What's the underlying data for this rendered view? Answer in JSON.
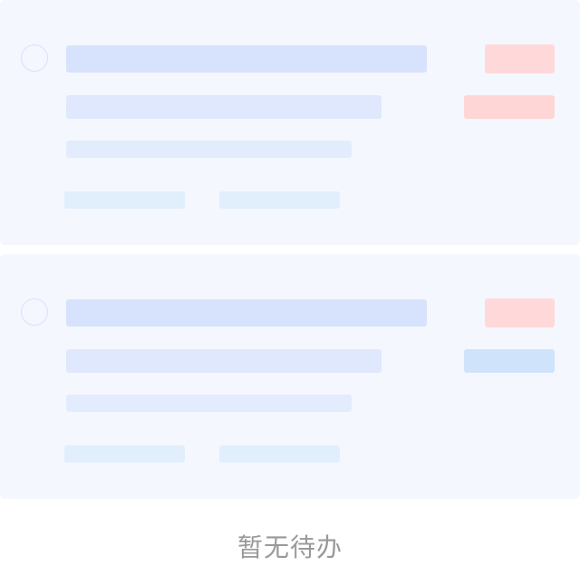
{
  "empty_state": {
    "message": "暂无待办"
  },
  "placeholder_cards": [
    {
      "status_tag_color": "#ffd9d9",
      "type_tag_color": "#ffd6d6"
    },
    {
      "status_tag_color": "#ffd9d9",
      "type_tag_color": "#cfe3fb"
    }
  ],
  "colors": {
    "card_background": "#f4f7fe",
    "title_placeholder": "#d7e2fc",
    "text_placeholder": "#dfe8fc",
    "meta_placeholder": "#e1eefc",
    "empty_text": "#999999"
  }
}
